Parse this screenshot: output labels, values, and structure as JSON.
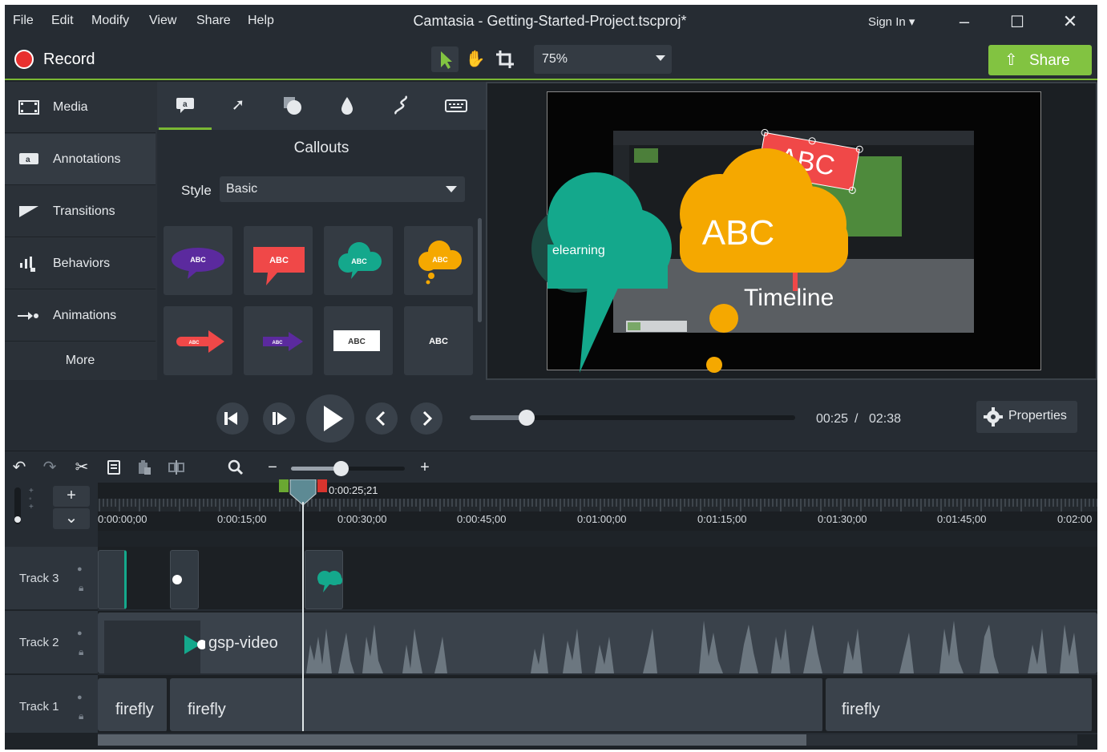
{
  "menu": {
    "items": [
      "File",
      "Edit",
      "Modify",
      "View",
      "Share",
      "Help"
    ]
  },
  "window": {
    "title": "Camtasia - Getting-Started-Project.tscproj*",
    "sign_in": "Sign In"
  },
  "toolbar": {
    "record_label": "Record",
    "zoom_value": "75%",
    "share_label": "Share"
  },
  "colors": {
    "accent_green": "#82c341",
    "record_red": "#e8302f",
    "teal": "#14a88c",
    "callout_yellow": "#f5a800",
    "callout_red": "#f04848",
    "callout_purple": "#5b2a9e"
  },
  "leftnav": {
    "items": [
      {
        "label": "Media",
        "icon": "film-icon"
      },
      {
        "label": "Annotations",
        "icon": "annotation-icon"
      },
      {
        "label": "Transitions",
        "icon": "transition-icon"
      },
      {
        "label": "Behaviors",
        "icon": "behaviors-icon"
      },
      {
        "label": "Animations",
        "icon": "animation-arrow-icon"
      }
    ],
    "more_label": "More"
  },
  "annotations": {
    "tabs": [
      "callout-tab-icon",
      "arrow-tab-icon",
      "shape-tab-icon",
      "blur-tab-icon",
      "sketch-motion-tab-icon",
      "keystroke-tab-icon"
    ],
    "title": "Callouts",
    "style_label": "Style",
    "style_value": "Basic",
    "tiles": [
      {
        "type": "speech-bubble",
        "text": "ABC",
        "color": "#5b2a9e"
      },
      {
        "type": "rect-speech",
        "text": "ABC",
        "color": "#f04848"
      },
      {
        "type": "cloud",
        "text": "ABC",
        "color": "#14a88c"
      },
      {
        "type": "thought-cloud",
        "text": "ABC",
        "color": "#f5a800"
      },
      {
        "type": "arrow",
        "text": "ABC",
        "color": "#f04848"
      },
      {
        "type": "arrow",
        "text": "ABC",
        "color": "#5b2a9e"
      },
      {
        "type": "box",
        "text": "ABC",
        "color": "#ffffff"
      },
      {
        "type": "text",
        "text": "ABC",
        "color": "#ffffff"
      }
    ]
  },
  "canvas": {
    "teal_cloud_text": "elearning",
    "yellow_cloud_text": "ABC",
    "red_sign_text": "ABC",
    "timeline_text": "Timeline"
  },
  "playback": {
    "current": "00:25",
    "separator": "/",
    "total": "02:38",
    "properties_label": "Properties",
    "progress": 0.158
  },
  "timeline": {
    "playhead_time": "0:00:25;21",
    "ruler": [
      "0:00:00;00",
      "0:00:15;00",
      "0:00:30;00",
      "0:00:45;00",
      "0:01:00;00",
      "0:01:15;00",
      "0:01:30;00",
      "0:01:45;00",
      "0:02:00"
    ],
    "tracks": [
      {
        "name": "Track 3"
      },
      {
        "name": "Track 2",
        "clip": "gsp-video"
      },
      {
        "name": "Track 1",
        "clips": [
          "firefly",
          "firefly",
          "firefly"
        ]
      }
    ]
  }
}
